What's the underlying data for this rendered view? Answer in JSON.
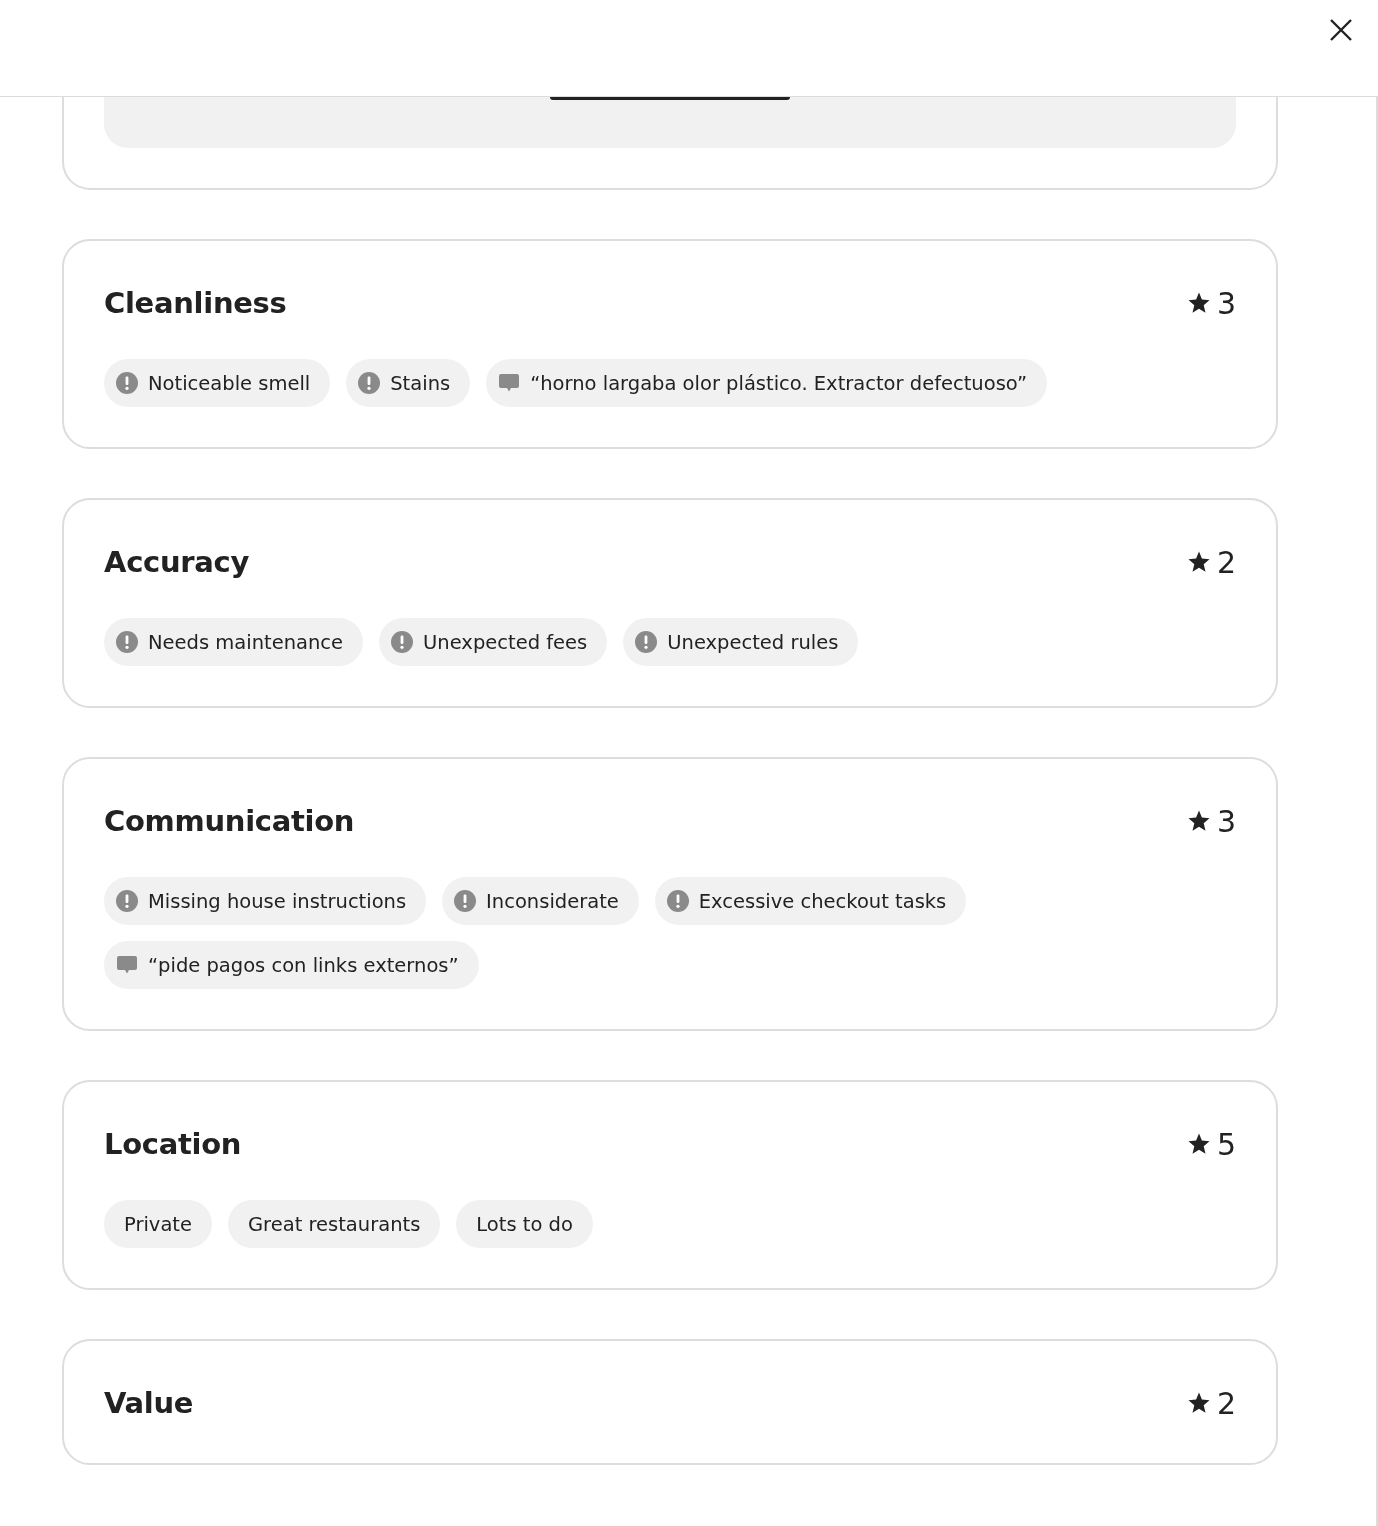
{
  "sections": [
    {
      "title": "Cleanliness",
      "rating": "3",
      "tags": [
        {
          "kind": "issue",
          "text": "Noticeable smell"
        },
        {
          "kind": "issue",
          "text": "Stains"
        },
        {
          "kind": "comment",
          "text": "“horno largaba olor plástico. Extractor defectuoso”"
        }
      ]
    },
    {
      "title": "Accuracy",
      "rating": "2",
      "tags": [
        {
          "kind": "issue",
          "text": "Needs maintenance"
        },
        {
          "kind": "issue",
          "text": "Unexpected fees"
        },
        {
          "kind": "issue",
          "text": "Unexpected rules"
        }
      ]
    },
    {
      "title": "Communication",
      "rating": "3",
      "tags": [
        {
          "kind": "issue",
          "text": "Missing house instructions"
        },
        {
          "kind": "issue",
          "text": "Inconsiderate"
        },
        {
          "kind": "issue",
          "text": "Excessive checkout tasks"
        },
        {
          "kind": "comment",
          "text": "“pide pagos con links externos”"
        }
      ]
    },
    {
      "title": "Location",
      "rating": "5",
      "tags": [
        {
          "kind": "plain",
          "text": "Private"
        },
        {
          "kind": "plain",
          "text": "Great restaurants"
        },
        {
          "kind": "plain",
          "text": "Lots to do"
        }
      ]
    },
    {
      "title": "Value",
      "rating": "2"
    }
  ]
}
